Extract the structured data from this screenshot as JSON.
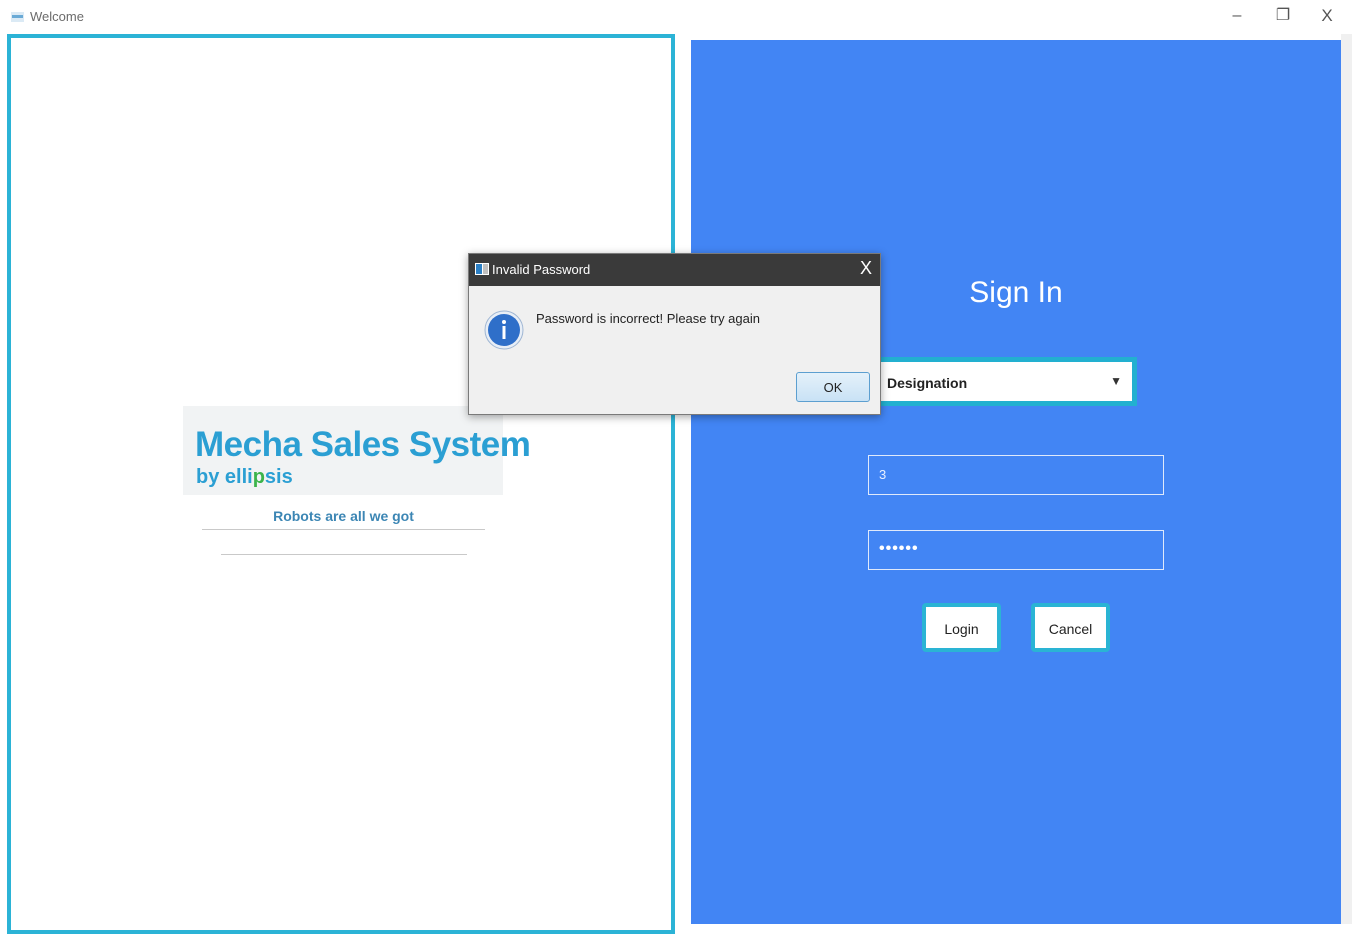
{
  "window": {
    "title": "Welcome",
    "minimize_glyph": "–",
    "restore_glyph": "❐",
    "close_glyph": "X"
  },
  "brand": {
    "name": "Mecha Sales System",
    "byline_prefix": "by elli",
    "byline_accent": "p",
    "byline_suffix": "sis",
    "tagline": "Robots are all we got"
  },
  "signin": {
    "title": "Sign In",
    "designation_label": "Designation",
    "username_value": "3",
    "password_value": "••••••",
    "login_label": "Login",
    "cancel_label": "Cancel"
  },
  "dialog": {
    "title": "Invalid Password",
    "close_glyph": "X",
    "message": "Password is incorrect! Please try again",
    "ok_label": "OK"
  },
  "colors": {
    "accent_cyan": "#2bb3d6",
    "panel_blue": "#4285f4",
    "logo_blue": "#2b9fd3"
  }
}
